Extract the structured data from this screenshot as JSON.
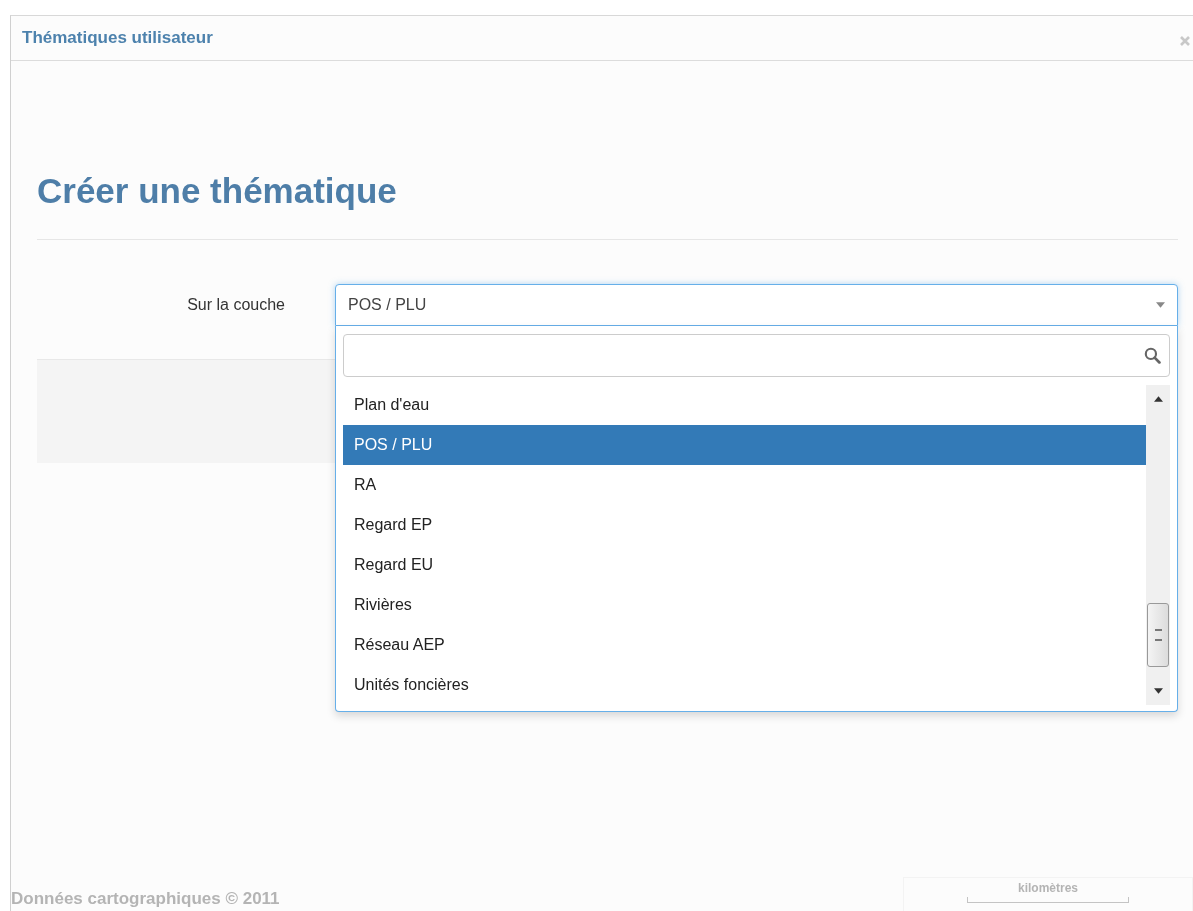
{
  "window": {
    "title": "Thématiques utilisateur"
  },
  "heading": "Créer une thématique",
  "form": {
    "label": "Sur la couche",
    "select": {
      "value": "POS / PLU",
      "expanded": true
    }
  },
  "dropdown": {
    "options": [
      {
        "label": "Plan d'eau",
        "selected": false
      },
      {
        "label": "POS / PLU",
        "selected": true
      },
      {
        "label": "RA",
        "selected": false
      },
      {
        "label": "Regard EP",
        "selected": false
      },
      {
        "label": "Regard EU",
        "selected": false
      },
      {
        "label": "Rivières",
        "selected": false
      },
      {
        "label": "Réseau AEP",
        "selected": false
      },
      {
        "label": "Unités foncières",
        "selected": false
      }
    ]
  },
  "background": {
    "attribution": "Données cartographiques © 2011",
    "scale_label": "kilomètres"
  }
}
